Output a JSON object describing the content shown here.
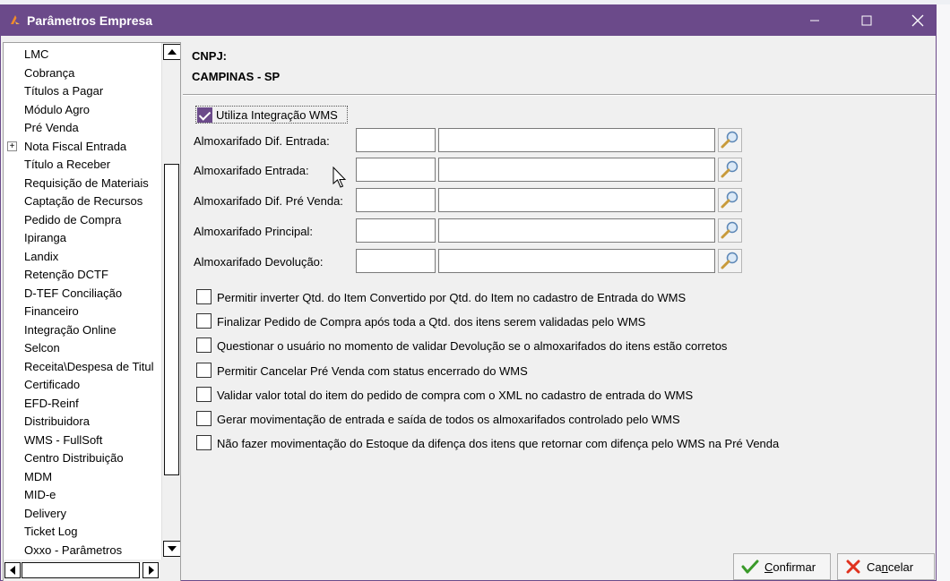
{
  "window": {
    "title": "Parâmetros Empresa",
    "accent": "#6b4a8a"
  },
  "tree": {
    "items": [
      {
        "label": "LMC"
      },
      {
        "label": "Cobrança"
      },
      {
        "label": "Títulos a Pagar"
      },
      {
        "label": "Módulo Agro"
      },
      {
        "label": "Pré Venda"
      },
      {
        "label": "Nota Fiscal Entrada",
        "expander": "+"
      },
      {
        "label": "Título a Receber"
      },
      {
        "label": "Requisição de Materiais"
      },
      {
        "label": "Captação de Recursos"
      },
      {
        "label": "Pedido de Compra"
      },
      {
        "label": "Ipiranga"
      },
      {
        "label": "Landix"
      },
      {
        "label": "Retenção DCTF"
      },
      {
        "label": "D-TEF Conciliação"
      },
      {
        "label": "Financeiro"
      },
      {
        "label": "Integração Online"
      },
      {
        "label": "Selcon"
      },
      {
        "label": "Receita\\Despesa de Titul"
      },
      {
        "label": "Certificado"
      },
      {
        "label": "EFD-Reinf"
      },
      {
        "label": "Distribuidora"
      },
      {
        "label": "WMS - FullSoft"
      },
      {
        "label": "Centro Distribuição"
      },
      {
        "label": "MDM"
      },
      {
        "label": "MID-e"
      },
      {
        "label": "Delivery"
      },
      {
        "label": "Ticket Log"
      },
      {
        "label": "Oxxo - Parâmetros"
      }
    ]
  },
  "company": {
    "cnpj_label": "CNPJ:",
    "city": "CAMPINAS - SP"
  },
  "wms": {
    "label": "Utiliza Integração WMS",
    "checked": true
  },
  "fields": [
    {
      "label": "Almoxarifado Dif. Entrada:",
      "code": "",
      "description": ""
    },
    {
      "label": "Almoxarifado Entrada:",
      "code": "",
      "description": ""
    },
    {
      "label": "Almoxarifado Dif. Pré Venda:",
      "code": "",
      "description": ""
    },
    {
      "label": "Almoxarifado Principal:",
      "code": "",
      "description": ""
    },
    {
      "label": "Almoxarifado Devolução:",
      "code": "",
      "description": ""
    }
  ],
  "options": [
    {
      "label": "Permitir inverter Qtd. do Item Convertido por Qtd. do Item no cadastro de Entrada do WMS",
      "checked": false
    },
    {
      "label": "Finalizar Pedido de Compra após toda a Qtd. dos itens serem validadas pelo WMS",
      "checked": false
    },
    {
      "label": "Questionar o usuário no momento de validar Devolução se o almoxarifados do itens estão corretos",
      "checked": false
    },
    {
      "label": "Permitir Cancelar Pré Venda com status encerrado do WMS",
      "checked": false
    },
    {
      "label": "Validar valor total do item do pedido de compra com o XML no cadastro de entrada do WMS",
      "checked": false
    },
    {
      "label": "Gerar movimentação de entrada e saída de todos os almoxarifados controlado pelo WMS",
      "checked": false
    },
    {
      "label": "Não fazer movimentação do Estoque da difença dos itens que retornar com difença pelo WMS na Pré Venda",
      "checked": false
    }
  ],
  "buttons": {
    "confirm": {
      "mnemonic": "C",
      "rest": "onfirmar",
      "icon": "check-icon",
      "color": "#3a9a2a"
    },
    "cancel": {
      "pre": "Ca",
      "mnemonic": "n",
      "rest": "celar",
      "icon": "x-icon",
      "color": "#e0321e"
    }
  }
}
